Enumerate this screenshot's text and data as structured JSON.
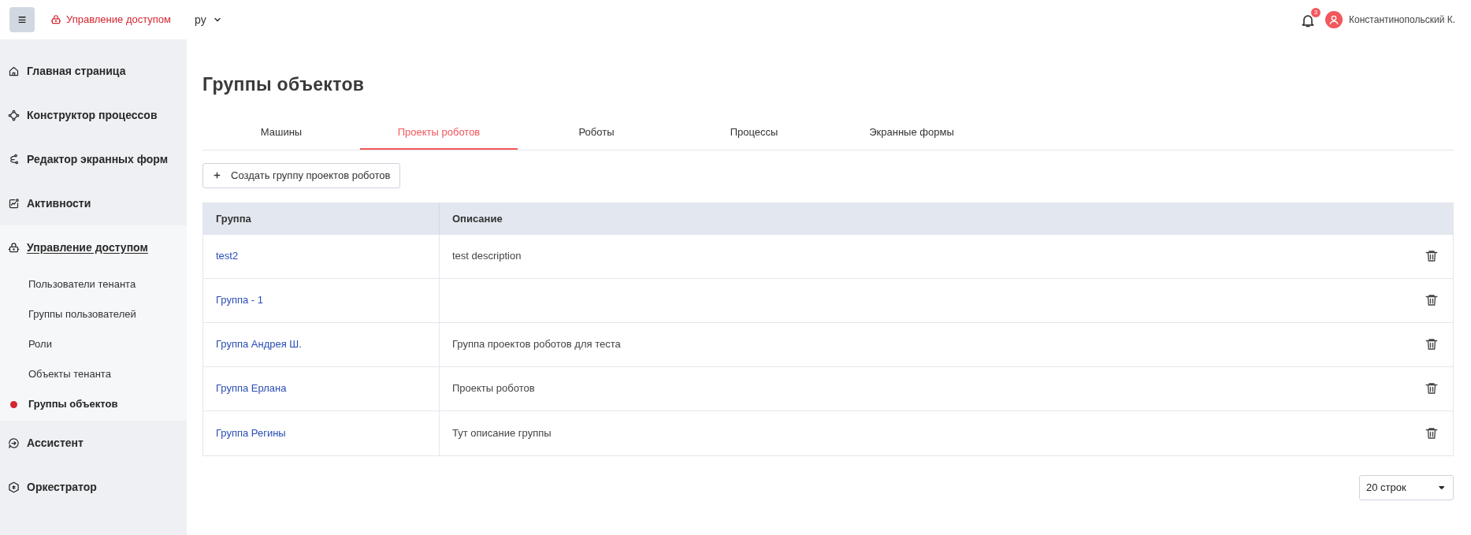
{
  "header": {
    "menu_button": "≡",
    "section_title": "Управление доступом",
    "language": "ру",
    "notification_count": "3",
    "user_name": "Константинопольский К."
  },
  "sidebar": {
    "items": [
      {
        "label": "Главная страница",
        "expanded": false
      },
      {
        "label": "Конструктор процессов",
        "expanded": false
      },
      {
        "label": "Редактор экранных форм",
        "expanded": false
      },
      {
        "label": "Активности",
        "expanded": false
      },
      {
        "label": "Управление доступом",
        "expanded": true,
        "children": [
          {
            "label": "Пользователи тенанта",
            "selected": false
          },
          {
            "label": "Группы пользователей",
            "selected": false
          },
          {
            "label": "Роли",
            "selected": false
          },
          {
            "label": "Объекты тенанта",
            "selected": false
          },
          {
            "label": "Группы объектов",
            "selected": true
          }
        ]
      },
      {
        "label": "Ассистент",
        "expanded": false
      },
      {
        "label": "Оркестратор",
        "expanded": false
      }
    ]
  },
  "page": {
    "title": "Группы объектов",
    "tabs": [
      {
        "label": "Машины",
        "selected": false
      },
      {
        "label": "Проекты роботов",
        "selected": true
      },
      {
        "label": "Роботы",
        "selected": false
      },
      {
        "label": "Процессы",
        "selected": false
      },
      {
        "label": "Экранные формы",
        "selected": false
      }
    ],
    "create_button": "Создать группу проектов роботов",
    "table": {
      "columns": [
        "Группа",
        "Описание"
      ],
      "rows": [
        {
          "group": "test2",
          "description": "test description"
        },
        {
          "group": "Группа - 1"
        },
        {
          "group": "Группа Андрея Ш.",
          "description": "Группа проектов роботов для теста"
        },
        {
          "group": "Группа Ерлана",
          "description": "Проекты роботов"
        },
        {
          "group": "Группа Регины",
          "description": "Тут описание группы"
        }
      ]
    },
    "rows_per_page": "20 строк"
  }
}
